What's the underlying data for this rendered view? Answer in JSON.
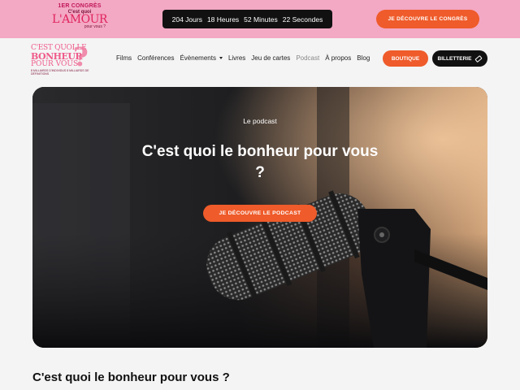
{
  "topbar": {
    "promo": {
      "congres": "1ER CONGRÈS",
      "cest_quoi": "C'est quoi",
      "amour": "L'AMOUR",
      "pour_vous": "pour vous ?"
    },
    "countdown": {
      "days": "204 Jours",
      "hours": "18 Heures",
      "minutes": "52 Minutes",
      "seconds": "22 Secondes"
    },
    "congres_button": "JE DÉCOUVRE LE CONGRÈS"
  },
  "header": {
    "brand": {
      "line1": "C'EST QUOI LE",
      "line2": "BONHEUR",
      "line3": "POUR VOUS",
      "line4": "8 MILLIARDS D'INDIVIDUS 8 MILLIARDS DE DÉFINITIONS",
      "mark": "?"
    },
    "nav": [
      {
        "label": "Films"
      },
      {
        "label": "Conférences"
      },
      {
        "label": "Évènements"
      },
      {
        "label": "Livres"
      },
      {
        "label": "Jeu de cartes"
      },
      {
        "label": "Podcast"
      },
      {
        "label": "À propos"
      },
      {
        "label": "Blog"
      }
    ],
    "boutique_button": "BOUTIQUE",
    "billetterie_button": "BILLETTERIE"
  },
  "hero": {
    "eyebrow": "Le podcast",
    "title": "C'est quoi le bonheur pour vous ?",
    "cta": "JE DÉCOUVRE LE PODCAST"
  },
  "section": {
    "title": "C'est quoi le bonheur pour vous ?"
  },
  "colors": {
    "topbar_bg": "#f3a8c3",
    "accent_orange": "#ef5b2a",
    "brand_pink": "#ef5b8a",
    "dark": "#111111"
  }
}
